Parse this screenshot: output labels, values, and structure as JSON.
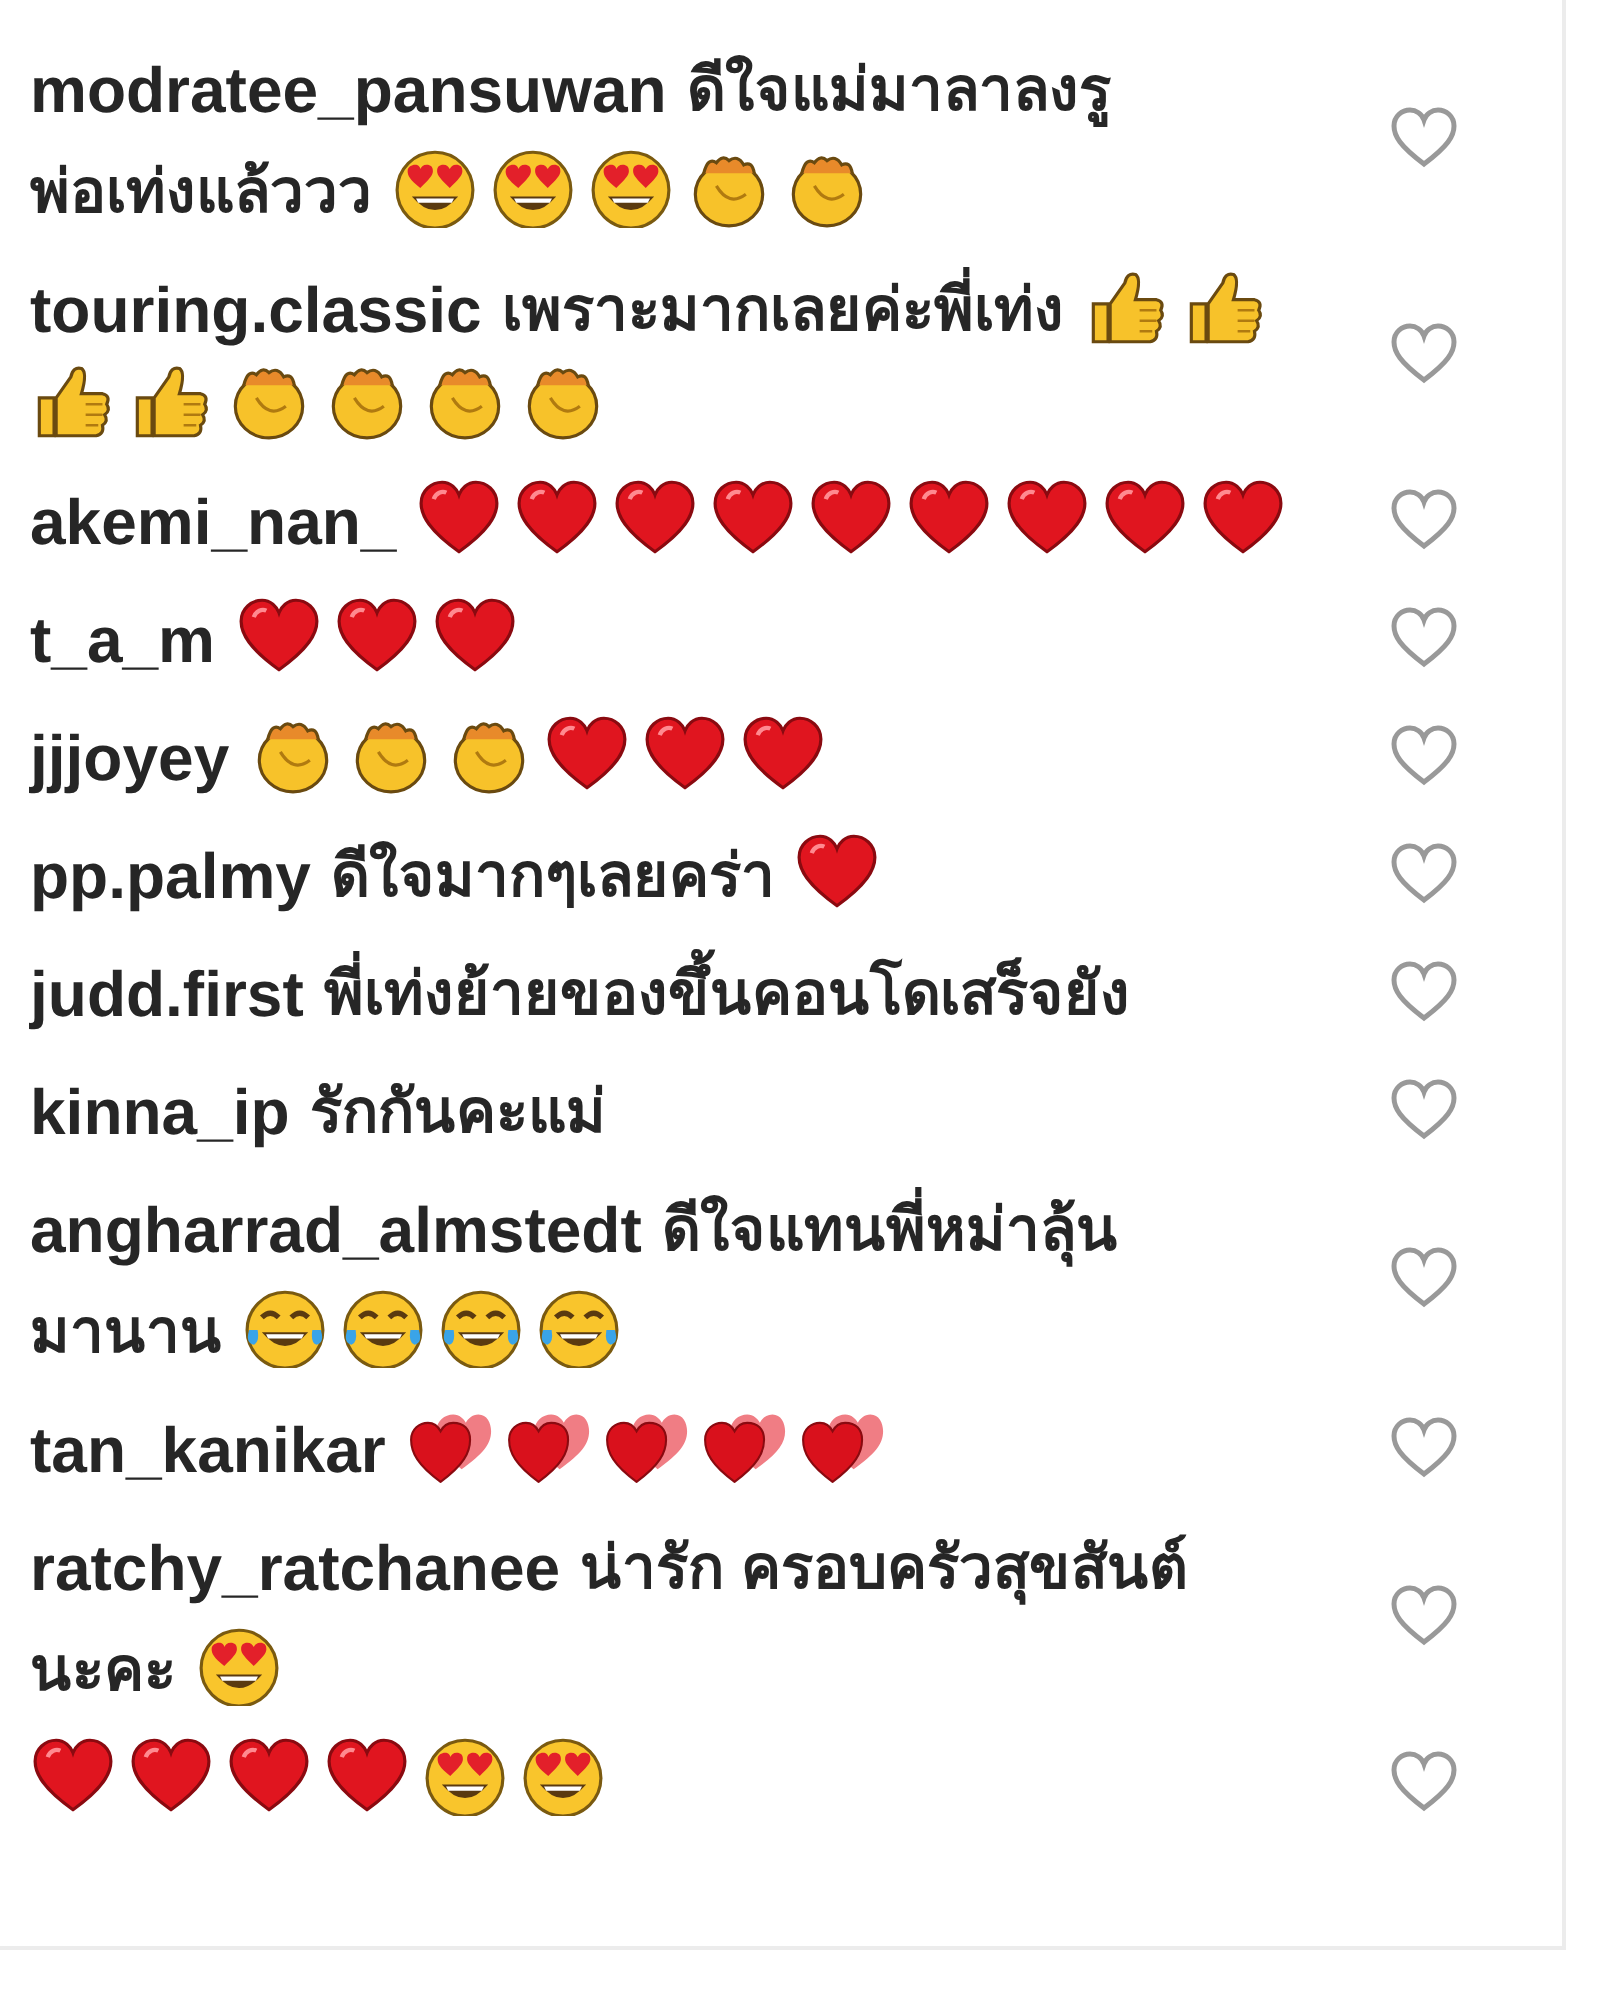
{
  "comments": [
    {
      "user": "modratee_pansuwan",
      "body": [
        {
          "kind": "text",
          "text": "ดีใจแม่มาลาลงรู"
        },
        {
          "kind": "text",
          "text": "พ่อเท่งแล้ววว"
        },
        {
          "kind": "heart_eyes"
        },
        {
          "kind": "heart_eyes"
        },
        {
          "kind": "heart_eyes"
        },
        {
          "kind": "clap"
        },
        {
          "kind": "clap"
        }
      ],
      "liked": false
    },
    {
      "user": "touring.classic",
      "body": [
        {
          "kind": "text",
          "text": "เพราะมากเลยค่ะพี่เท่ง"
        },
        {
          "kind": "thumbs_up"
        },
        {
          "kind": "thumbs_up"
        },
        {
          "kind": "thumbs_up"
        },
        {
          "kind": "thumbs_up"
        },
        {
          "kind": "clap"
        },
        {
          "kind": "clap"
        },
        {
          "kind": "clap"
        },
        {
          "kind": "clap"
        }
      ],
      "liked": false
    },
    {
      "user": "akemi_nan_",
      "body": [
        {
          "kind": "heart"
        },
        {
          "kind": "heart"
        },
        {
          "kind": "heart"
        },
        {
          "kind": "heart"
        },
        {
          "kind": "heart"
        },
        {
          "kind": "heart"
        },
        {
          "kind": "heart"
        },
        {
          "kind": "heart"
        },
        {
          "kind": "heart"
        }
      ],
      "liked": false
    },
    {
      "user": "t_a_m",
      "body": [
        {
          "kind": "heart"
        },
        {
          "kind": "heart"
        },
        {
          "kind": "heart"
        }
      ],
      "liked": false
    },
    {
      "user": "jjjoyey",
      "body": [
        {
          "kind": "clap"
        },
        {
          "kind": "clap"
        },
        {
          "kind": "clap"
        },
        {
          "kind": "heart"
        },
        {
          "kind": "heart"
        },
        {
          "kind": "heart"
        }
      ],
      "liked": false
    },
    {
      "user": "pp.palmy",
      "body": [
        {
          "kind": "text",
          "text": "ดีใจมากๆเลยคร่า"
        },
        {
          "kind": "heart"
        }
      ],
      "liked": false
    },
    {
      "user": "judd.first",
      "body": [
        {
          "kind": "text",
          "text": "พี่เท่งย้ายของขึ้นคอนโดเสร็จยัง"
        }
      ],
      "liked": false
    },
    {
      "user": "kinna_ip",
      "body": [
        {
          "kind": "text",
          "text": "รักกันคะแม่"
        }
      ],
      "liked": false
    },
    {
      "user": "angharrad_almstedt",
      "body": [
        {
          "kind": "text",
          "text": "ดีใจแทนพี่หม่าลุ้น"
        },
        {
          "kind": "text",
          "text": "มานาน"
        },
        {
          "kind": "tears_of_joy"
        },
        {
          "kind": "tears_of_joy"
        },
        {
          "kind": "tears_of_joy"
        },
        {
          "kind": "tears_of_joy"
        }
      ],
      "liked": false
    },
    {
      "user": "tan_kanikar",
      "body": [
        {
          "kind": "two_hearts"
        },
        {
          "kind": "two_hearts"
        },
        {
          "kind": "two_hearts"
        },
        {
          "kind": "two_hearts"
        },
        {
          "kind": "two_hearts"
        }
      ],
      "liked": false
    },
    {
      "user": "ratchy_ratchanee",
      "body": [
        {
          "kind": "text",
          "text": "น่ารัก ครอบครัวสุขสันต์"
        },
        {
          "kind": "text",
          "text": "นะคะ"
        },
        {
          "kind": "heart_eyes"
        }
      ],
      "liked": false
    },
    {
      "body": [
        {
          "kind": "heart"
        },
        {
          "kind": "heart"
        },
        {
          "kind": "heart"
        },
        {
          "kind": "heart"
        },
        {
          "kind": "heart_eyes"
        },
        {
          "kind": "heart_eyes"
        }
      ],
      "liked": false
    }
  ]
}
